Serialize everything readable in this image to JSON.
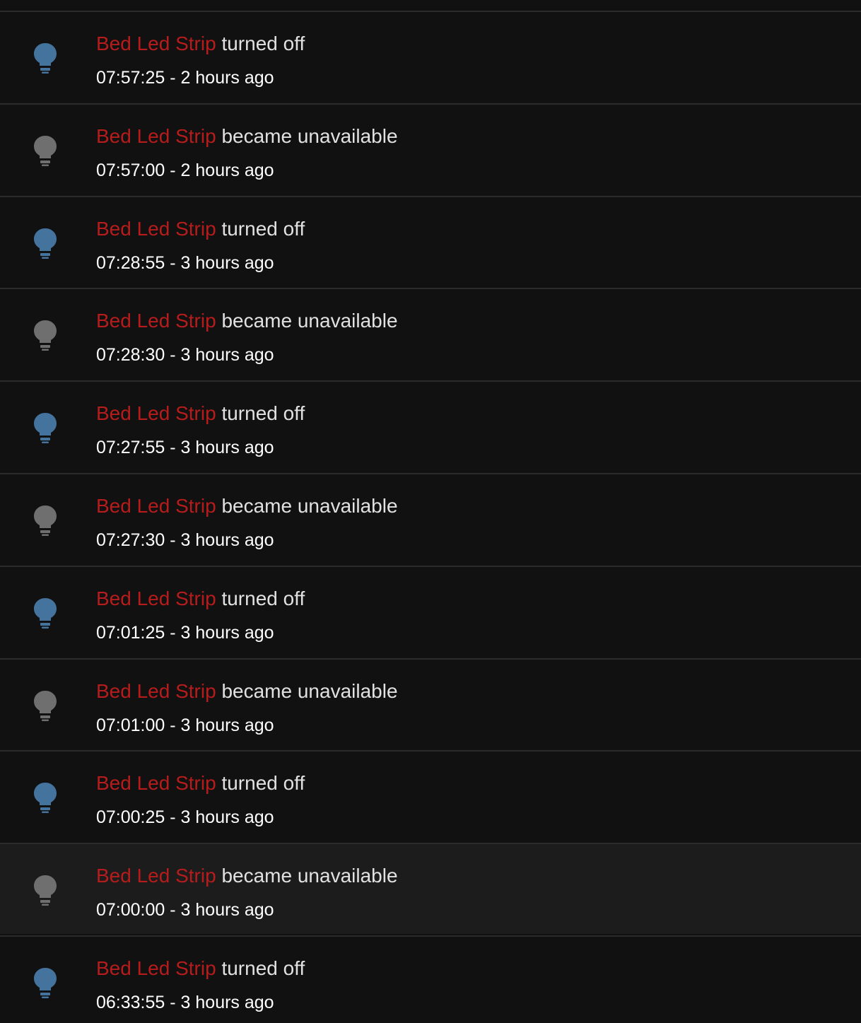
{
  "colors": {
    "background": "#111111",
    "row_hover": "#1c1c1c",
    "divider": "#2b2b2b",
    "entity_link": "#b71c1c",
    "message_text": "#e1e1e1",
    "time_text": "#ffffff",
    "icon_on": "#44739e",
    "icon_unavailable": "#6f6f6f"
  },
  "entries": [
    {
      "entity": "Bed Led Strip",
      "message": "turned off",
      "time": "07:57:25 - 2 hours ago",
      "icon": "lightbulb-icon",
      "state": "off"
    },
    {
      "entity": "Bed Led Strip",
      "message": "became unavailable",
      "time": "07:57:00 - 2 hours ago",
      "icon": "lightbulb-icon",
      "state": "unavailable"
    },
    {
      "entity": "Bed Led Strip",
      "message": "turned off",
      "time": "07:28:55 - 3 hours ago",
      "icon": "lightbulb-icon",
      "state": "off"
    },
    {
      "entity": "Bed Led Strip",
      "message": "became unavailable",
      "time": "07:28:30 - 3 hours ago",
      "icon": "lightbulb-icon",
      "state": "unavailable"
    },
    {
      "entity": "Bed Led Strip",
      "message": "turned off",
      "time": "07:27:55 - 3 hours ago",
      "icon": "lightbulb-icon",
      "state": "off"
    },
    {
      "entity": "Bed Led Strip",
      "message": "became unavailable",
      "time": "07:27:30 - 3 hours ago",
      "icon": "lightbulb-icon",
      "state": "unavailable"
    },
    {
      "entity": "Bed Led Strip",
      "message": "turned off",
      "time": "07:01:25 - 3 hours ago",
      "icon": "lightbulb-icon",
      "state": "off"
    },
    {
      "entity": "Bed Led Strip",
      "message": "became unavailable",
      "time": "07:01:00 - 3 hours ago",
      "icon": "lightbulb-icon",
      "state": "unavailable"
    },
    {
      "entity": "Bed Led Strip",
      "message": "turned off",
      "time": "07:00:25 - 3 hours ago",
      "icon": "lightbulb-icon",
      "state": "off"
    },
    {
      "entity": "Bed Led Strip",
      "message": "became unavailable",
      "time": "07:00:00 - 3 hours ago",
      "icon": "lightbulb-icon",
      "state": "unavailable",
      "hovered": true
    },
    {
      "entity": "Bed Led Strip",
      "message": "turned off",
      "time": "06:33:55 - 3 hours ago",
      "icon": "lightbulb-icon",
      "state": "off"
    }
  ]
}
